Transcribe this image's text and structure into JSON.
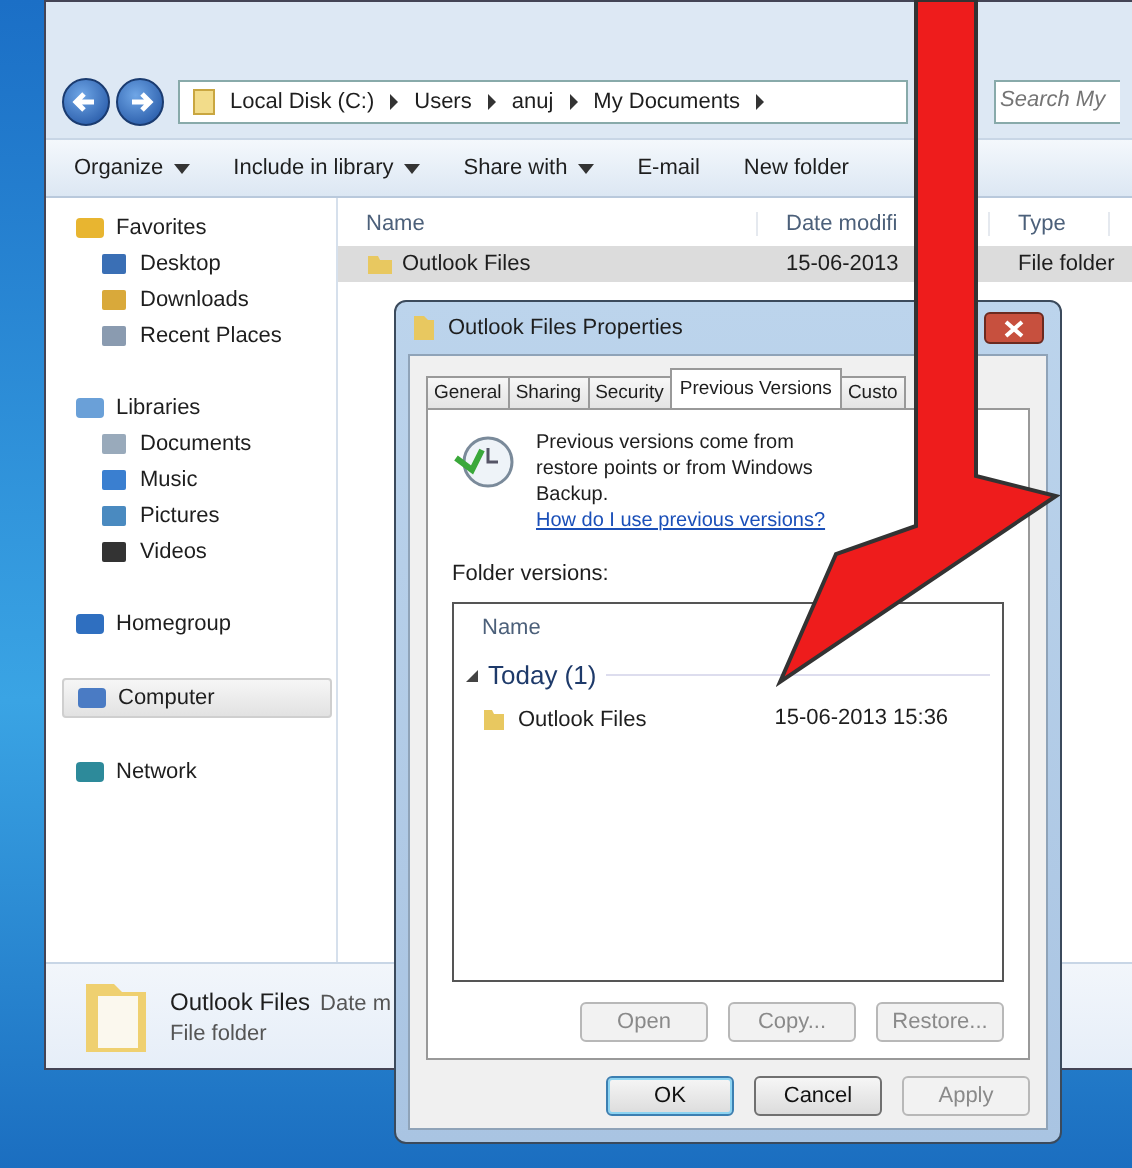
{
  "explorer": {
    "address": {
      "crumbs": [
        "Local Disk (C:)",
        "Users",
        "anuj",
        "My Documents"
      ]
    },
    "search": {
      "placeholder": "Search My"
    },
    "toolbar": [
      {
        "label": "Organize",
        "menu": true
      },
      {
        "label": "Include in library",
        "menu": true
      },
      {
        "label": "Share with",
        "menu": true
      },
      {
        "label": "E-mail",
        "menu": false
      },
      {
        "label": "New folder",
        "menu": false
      }
    ],
    "nav": [
      {
        "label": "Favorites",
        "kind": "favorites",
        "selected": false,
        "children": [
          {
            "label": "Desktop",
            "kind": "desktop",
            "selected": false
          },
          {
            "label": "Downloads",
            "kind": "downloads",
            "selected": false
          },
          {
            "label": "Recent Places",
            "kind": "recent",
            "selected": false
          }
        ]
      },
      {
        "label": "Libraries",
        "kind": "libraries",
        "selected": false,
        "children": [
          {
            "label": "Documents",
            "kind": "documents",
            "selected": false
          },
          {
            "label": "Music",
            "kind": "music",
            "selected": false
          },
          {
            "label": "Pictures",
            "kind": "pictures",
            "selected": false
          },
          {
            "label": "Videos",
            "kind": "videos",
            "selected": false
          }
        ]
      },
      {
        "label": "Homegroup",
        "kind": "homegroup",
        "selected": false
      },
      {
        "label": "Computer",
        "kind": "computer",
        "selected": true
      },
      {
        "label": "Network",
        "kind": "network",
        "selected": false
      }
    ],
    "columns": [
      "Name",
      "Date modifi",
      "Type"
    ],
    "rows": [
      {
        "name": "Outlook Files",
        "date": "15-06-2013",
        "type": "File folder",
        "selected": true
      }
    ],
    "details": {
      "name": "Outlook Files",
      "date": "Date m",
      "type": "File folder"
    }
  },
  "dialog": {
    "title": "Outlook Files Properties",
    "tabs": [
      {
        "label": "General",
        "selected": false
      },
      {
        "label": "Sharing",
        "selected": false
      },
      {
        "label": "Security",
        "selected": false
      },
      {
        "label": "Previous Versions",
        "selected": true
      },
      {
        "label": "Custo",
        "selected": false
      }
    ],
    "info": "Previous versions come from restore points or from Windows Backup.",
    "link": "How do I use previous versions?",
    "versions_label": "Folder versions:",
    "list_column": "Name",
    "group": {
      "label": "Today (1)",
      "expanded": true,
      "items": [
        {
          "name": "Outlook Files",
          "date": "15-06-2013 15:36"
        }
      ]
    },
    "actions": [
      {
        "label": "Open",
        "disabled": true
      },
      {
        "label": "Copy...",
        "disabled": true
      },
      {
        "label": "Restore...",
        "disabled": true
      }
    ],
    "buttons": [
      {
        "label": "OK",
        "default": true,
        "disabled": false
      },
      {
        "label": "Cancel",
        "default": false,
        "disabled": false
      },
      {
        "label": "Apply",
        "default": false,
        "disabled": true
      }
    ]
  }
}
